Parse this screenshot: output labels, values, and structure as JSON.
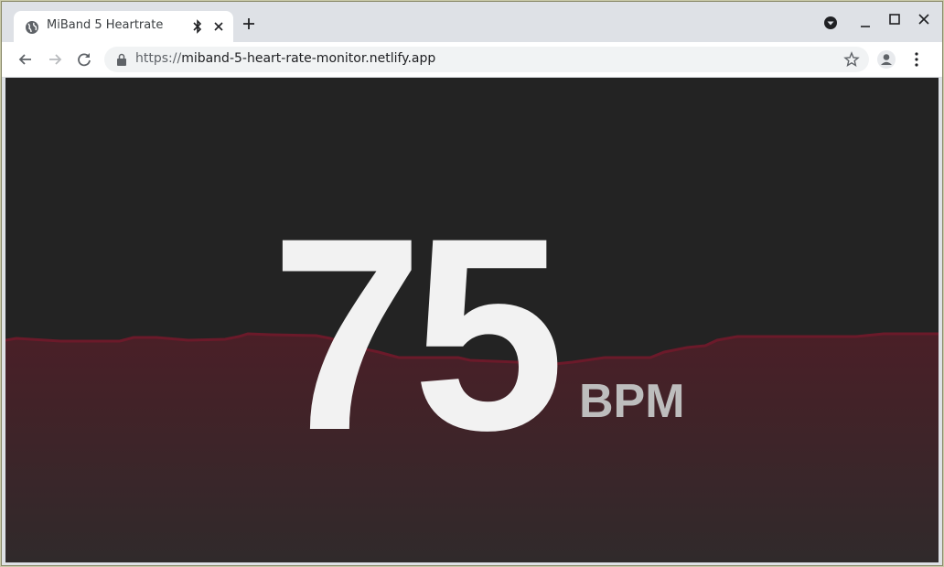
{
  "browser": {
    "tab": {
      "title": "MiBand 5 Heartrate"
    },
    "address": {
      "scheme": "https://",
      "host": "miband-5-heart-rate-monitor.netlify.app"
    }
  },
  "app": {
    "bpm": "75",
    "unit": "BPM",
    "colors": {
      "background": "#232323",
      "graph_line": "#6b1a2a",
      "graph_fill": "#4a1e26",
      "text": "#f2f2f2"
    }
  }
}
